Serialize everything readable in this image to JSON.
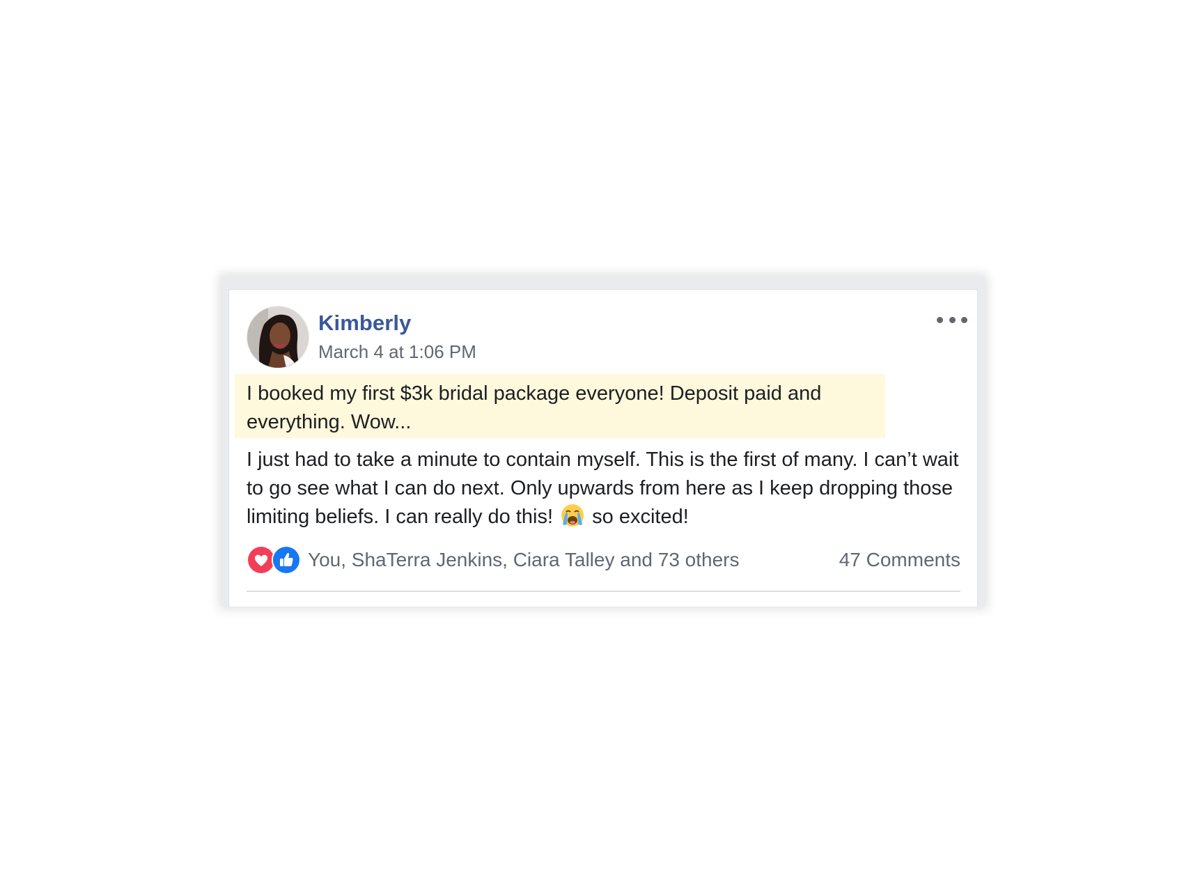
{
  "post": {
    "author": "Kimberly",
    "timestamp": "March 4 at 1:06 PM",
    "highlighted_text": "I booked my first $3k bridal package everyone! Deposit paid and everything. Wow...",
    "body_before_emoji": "I just had to take a minute to contain myself. This is the first of many. I can’t wait to go see what I can do next. Only upwards from here as I keep dropping those limiting beliefs. I can really do this!",
    "body_after_emoji": "so excited!",
    "emoji_icon": "loudly-crying-face-icon"
  },
  "reactions": {
    "icons": [
      "heart-reaction-icon",
      "like-reaction-icon"
    ],
    "names": "You, ShaTerra Jenkins, Ciara Talley and 73 others",
    "comments": "47 Comments"
  },
  "colors": {
    "author_link": "#385898",
    "highlight_bg": "#fef8dc",
    "love_red": "#f33e58",
    "like_blue": "#1877f2",
    "meta_gray": "#606770"
  }
}
